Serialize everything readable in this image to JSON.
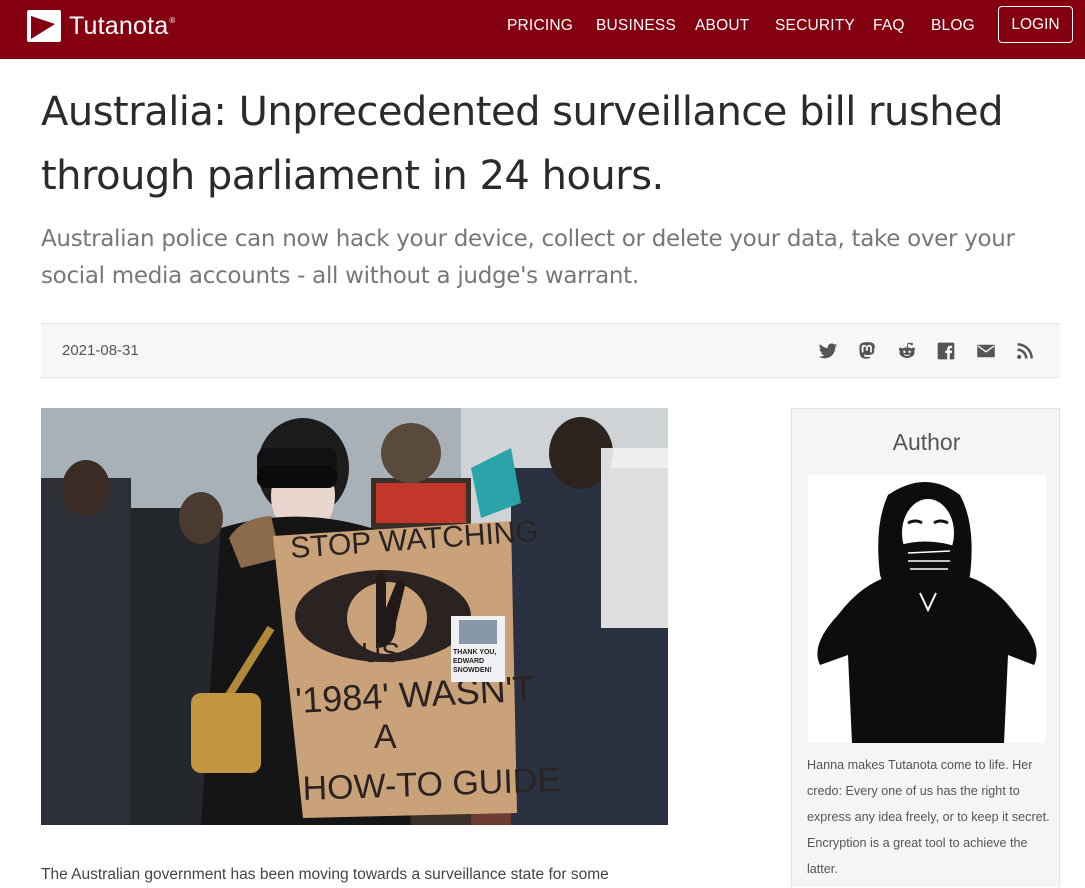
{
  "brand": {
    "name": "Tutanota",
    "registered_mark": "®",
    "color": "#840010"
  },
  "nav": {
    "items": [
      {
        "label": "PRICING"
      },
      {
        "label": "BUSINESS"
      },
      {
        "label": "ABOUT"
      },
      {
        "label": "SECURITY"
      },
      {
        "label": "FAQ"
      },
      {
        "label": "BLOG"
      }
    ],
    "login_label": "LOGIN"
  },
  "article": {
    "title": "Australia: Unprecedented surveillance bill rushed through parliament in 24 hours.",
    "subtitle": "Australian police can now hack your device, collect or delete your data, take over your social media accounts - all without a judge's warrant.",
    "date": "2021-08-31",
    "share_icons": [
      "twitter-icon",
      "mastodon-icon",
      "reddit-icon",
      "facebook-icon",
      "email-icon",
      "rss-icon"
    ],
    "hero_image": {
      "sign_lines": [
        "STOP WATCHING",
        "US",
        "'1984' WASN'T",
        "A",
        "HOW-TO GUIDE"
      ],
      "sticker_lines": [
        "THANK YOU,",
        "EDWARD",
        "SNOWDEN!"
      ]
    },
    "body_first_line": "The Australian government has been moving towards a surveillance state for some"
  },
  "author": {
    "heading": "Author",
    "bio": "Hanna makes Tutanota come to life. Her credo: Every one of us has the right to express any idea freely, or to keep it secret. Encryption is a great tool to achieve the latter."
  }
}
